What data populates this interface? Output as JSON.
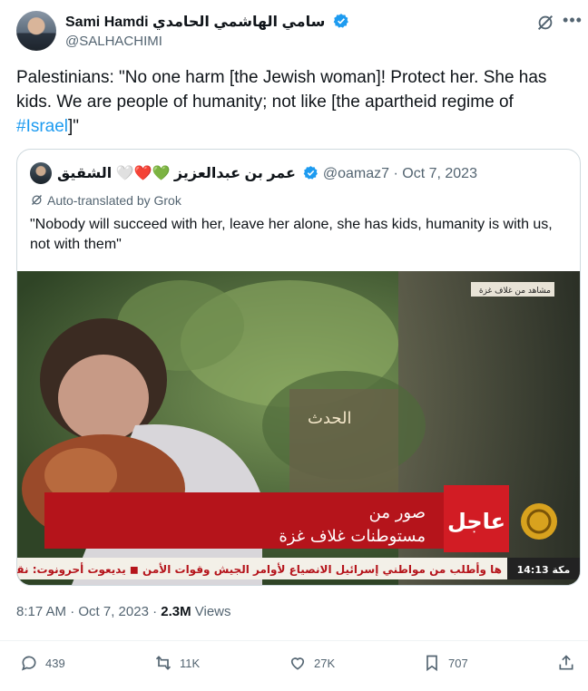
{
  "tweet": {
    "author_name": "Sami Hamdi سامي الهاشمي الحامدي",
    "handle": "@SALHACHIMI",
    "text_main": "Palestinians: \"No one harm [the Jewish woman]! Protect her. She has kids. We are people of humanity; not like [the apartheid regime of ",
    "hashtag": "#Israel",
    "text_end": "]\"",
    "time": "8:17 AM · Oct 7, 2023 · ",
    "views_count": "2.3M",
    "views_label": " Views"
  },
  "quote": {
    "author_name": "عمر بن عبدالعزيز 💚❤️🤍 الشقيق",
    "handle": "@oamaz7",
    "date": "· Oct 7, 2023",
    "translated_label": "Auto-translated by Grok",
    "text": "\"Nobody will succeed with her, leave her alone, she has kids, humanity is with us, not with them\""
  },
  "video": {
    "top_tag": "مشاهد من غلاف غزة",
    "channel_bug": "الحدث",
    "urgent_label": "عاجل",
    "headline_line1": "صور من",
    "headline_line2": "مستوطنات غلاف غزة",
    "ticker_time": "14:13 مكة",
    "ticker_text": "ها وأطلب من مواطني إسرائيل الانصياع لأوامر الجيش وقوات الأمن  ◼  يديعوت أحرونوت: نقل"
  },
  "actions": {
    "replies": "439",
    "reposts": "11K",
    "likes": "27K",
    "bookmarks": "707"
  },
  "colors": {
    "link": "#1d9bf0",
    "verified": "#1d9bf0",
    "muted": "#536471",
    "urgent_red": "#c8171f"
  }
}
